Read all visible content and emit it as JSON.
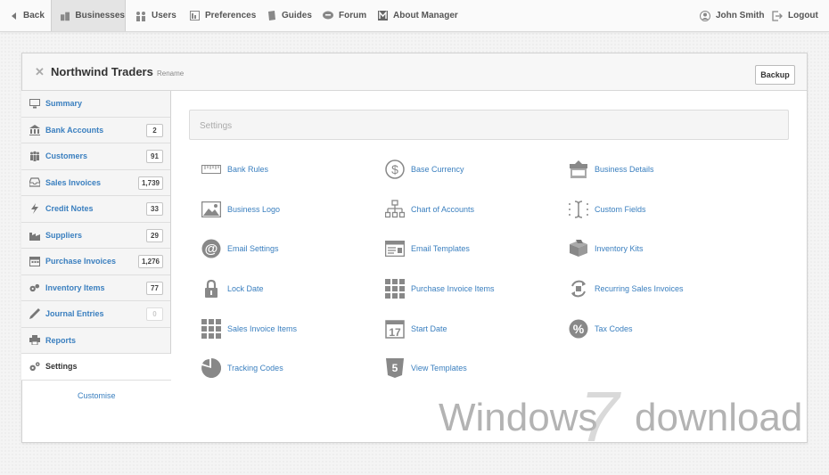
{
  "topnav": {
    "back": "Back",
    "businesses": "Businesses",
    "users": "Users",
    "preferences": "Preferences",
    "guides": "Guides",
    "forum": "Forum",
    "about": "About Manager",
    "user": "John Smith",
    "logout": "Logout"
  },
  "business": {
    "name": "Northwind Traders",
    "rename": "Rename",
    "backup": "Backup"
  },
  "sidebar": {
    "items": [
      {
        "label": "Summary",
        "count": "",
        "icon": "monitor-icon"
      },
      {
        "label": "Bank Accounts",
        "count": "2",
        "icon": "bank-icon"
      },
      {
        "label": "Customers",
        "count": "91",
        "icon": "people-icon"
      },
      {
        "label": "Sales Invoices",
        "count": "1,739",
        "icon": "tray-icon"
      },
      {
        "label": "Credit Notes",
        "count": "33",
        "icon": "bolt-icon"
      },
      {
        "label": "Suppliers",
        "count": "29",
        "icon": "factory-icon"
      },
      {
        "label": "Purchase Invoices",
        "count": "1,276",
        "icon": "calendar-icon"
      },
      {
        "label": "Inventory Items",
        "count": "77",
        "icon": "boxes-icon"
      },
      {
        "label": "Journal Entries",
        "count": "0",
        "icon": "pen-icon"
      },
      {
        "label": "Reports",
        "count": "",
        "icon": "printer-icon"
      },
      {
        "label": "Settings",
        "count": "",
        "icon": "gears-icon"
      }
    ],
    "customise": "Customise"
  },
  "settings": {
    "title": "Settings",
    "items": [
      "Bank Rules",
      "Base Currency",
      "Business Details",
      "Business Logo",
      "Chart of Accounts",
      "Custom Fields",
      "Email Settings",
      "Email Templates",
      "Inventory Kits",
      "Lock Date",
      "Purchase Invoice Items",
      "Recurring Sales Invoices",
      "Sales Invoice Items",
      "Start Date",
      "Tax Codes",
      "Tracking Codes",
      "View Templates"
    ]
  },
  "watermark": {
    "left": "Windows",
    "right": "download",
    "digit": "7"
  },
  "colors": {
    "link": "#3a7fbf",
    "icon": "#888888"
  }
}
